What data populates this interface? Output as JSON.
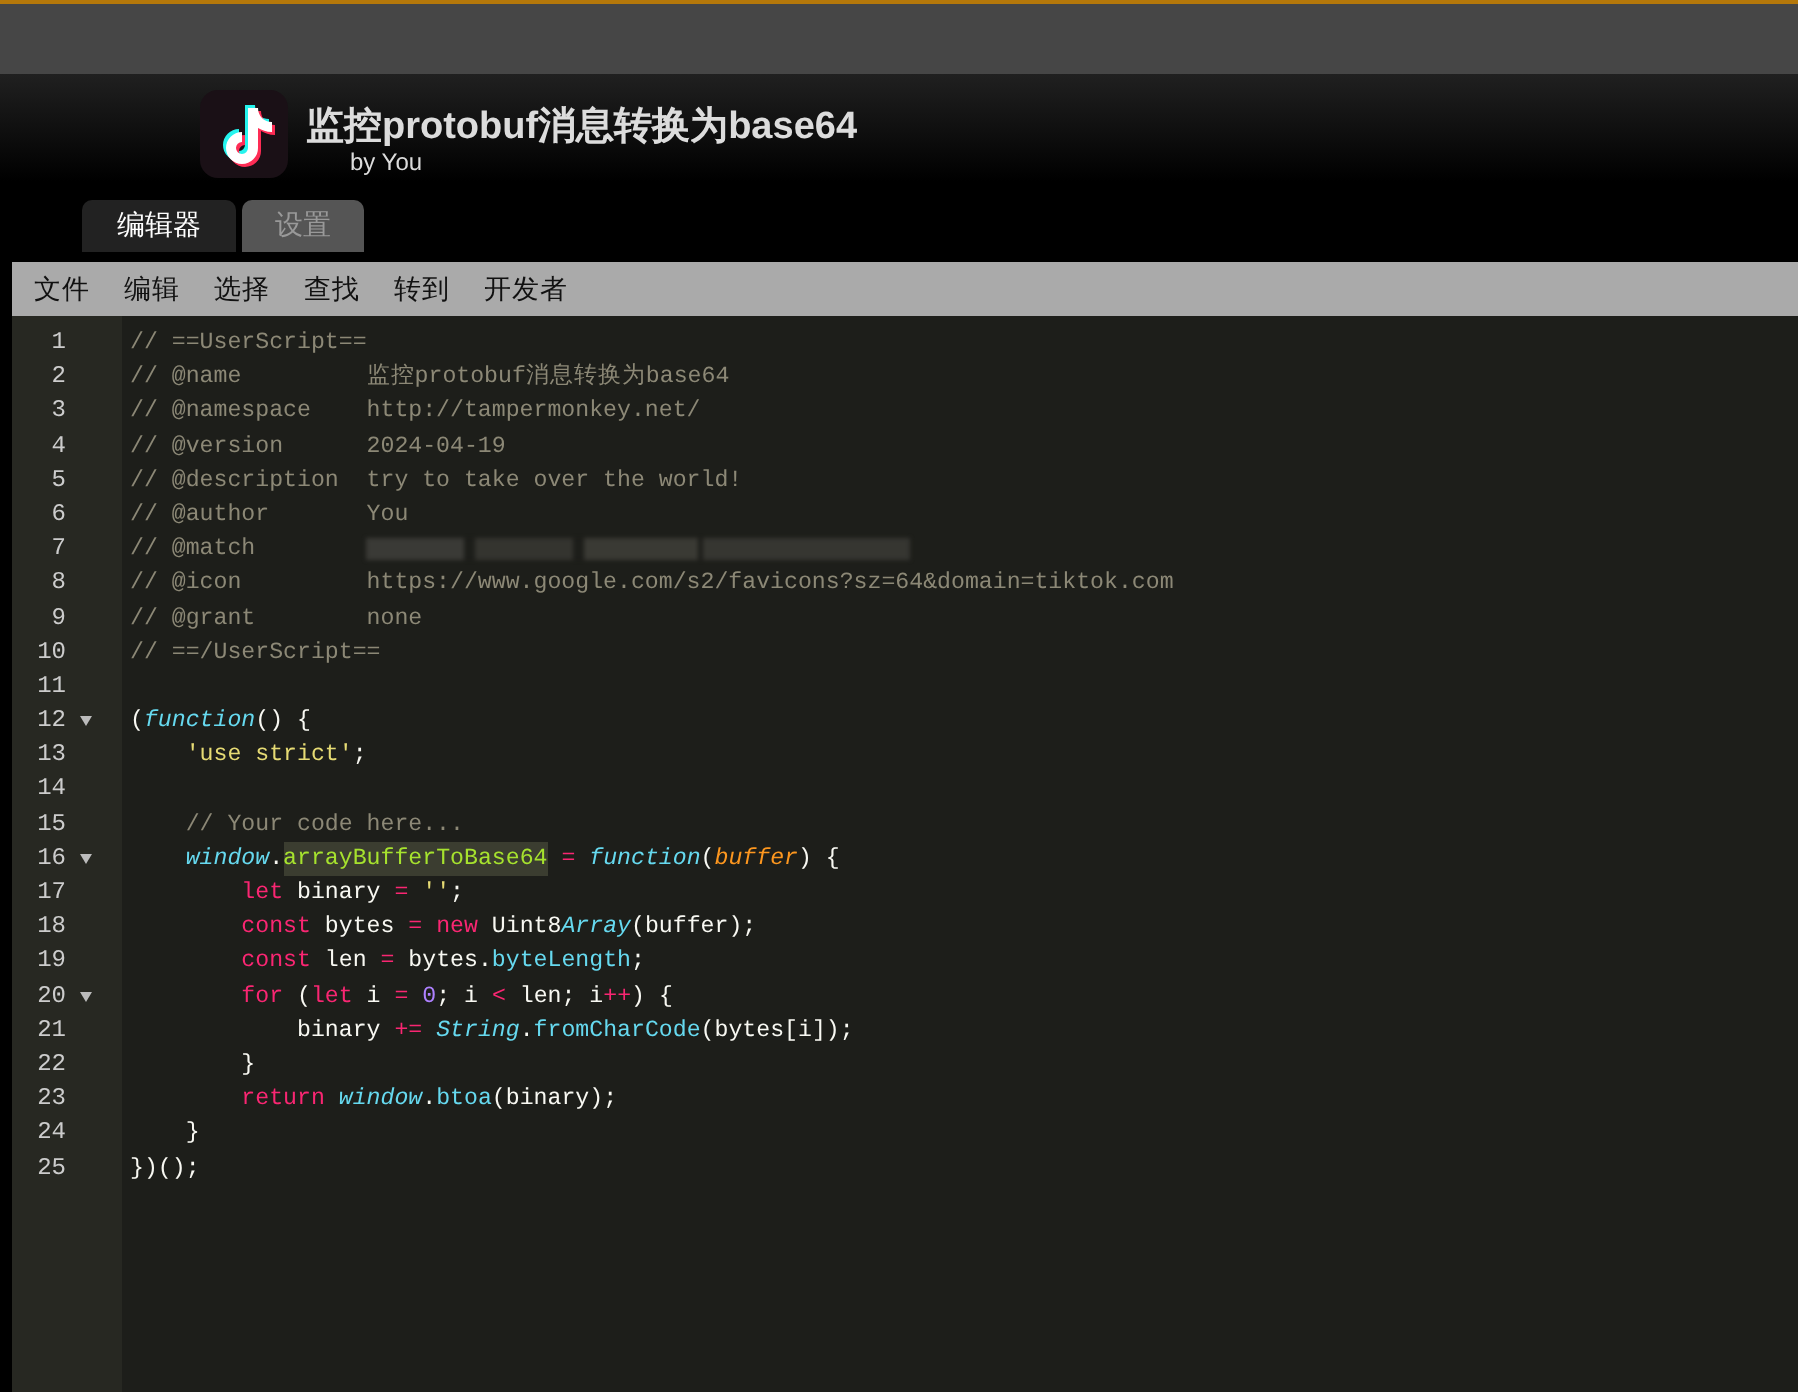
{
  "header": {
    "title": "监控protobuf消息转换为base64",
    "author": "by You"
  },
  "tabs": [
    {
      "label": "编辑器",
      "selected": true
    },
    {
      "label": "设置",
      "selected": false
    }
  ],
  "menu": [
    "文件",
    "编辑",
    "选择",
    "查找",
    "转到",
    "开发者"
  ],
  "code_lines": [
    {
      "number": "1",
      "foldable": false,
      "tokens": [
        {
          "text": "// ==UserScript==",
          "kind": "comment"
        }
      ]
    },
    {
      "number": "2",
      "foldable": false,
      "tokens": [
        {
          "text": "// @name         监控protobuf消息转换为base64",
          "kind": "comment"
        }
      ]
    },
    {
      "number": "3",
      "foldable": false,
      "tokens": [
        {
          "text": "// @namespace    http://tampermonkey.net/",
          "kind": "comment"
        }
      ]
    },
    {
      "number": "4",
      "foldable": false,
      "tokens": [
        {
          "text": "// @version      2024-04-19",
          "kind": "comment"
        }
      ]
    },
    {
      "number": "5",
      "foldable": false,
      "tokens": [
        {
          "text": "// @description  try to take over the world!",
          "kind": "comment"
        }
      ]
    },
    {
      "number": "6",
      "foldable": false,
      "tokens": [
        {
          "text": "// @author       You",
          "kind": "comment"
        }
      ]
    },
    {
      "number": "7",
      "foldable": false,
      "tokens": [
        {
          "text": "// @match        ",
          "kind": "comment"
        },
        {
          "kind": "redacted"
        }
      ]
    },
    {
      "number": "8",
      "foldable": false,
      "tokens": [
        {
          "text": "// @icon         https://www.google.com/s2/favicons?sz=64&domain=tiktok.com",
          "kind": "comment"
        }
      ]
    },
    {
      "number": "9",
      "foldable": false,
      "tokens": [
        {
          "text": "// @grant        none",
          "kind": "comment"
        }
      ]
    },
    {
      "number": "10",
      "foldable": false,
      "tokens": [
        {
          "text": "// ==/UserScript==",
          "kind": "comment"
        }
      ]
    },
    {
      "number": "11",
      "foldable": false
    },
    {
      "number": "12",
      "foldable": true,
      "tokens": [
        {
          "text": "(",
          "kind": "plain"
        },
        {
          "text": "function",
          "kind": "storage"
        },
        {
          "text": "() {",
          "kind": "plain"
        }
      ]
    },
    {
      "number": "13",
      "foldable": false,
      "tokens": [
        {
          "text": "    'use strict'",
          "kind": "string"
        },
        {
          "text": ";",
          "kind": "plain"
        }
      ]
    },
    {
      "number": "14",
      "foldable": false
    },
    {
      "number": "15",
      "foldable": false,
      "tokens": [
        {
          "text": "    // Your code here...",
          "kind": "comment"
        }
      ]
    },
    {
      "number": "16",
      "foldable": true,
      "tokens": [
        {
          "text": "    window",
          "kind": "storage"
        },
        {
          "text": ".",
          "kind": "plain"
        },
        {
          "text": "arrayBufferToBase64",
          "kind": "function-name"
        },
        {
          "text": " =",
          "kind": "keyword"
        },
        {
          "text": " function",
          "kind": "storage"
        },
        {
          "text": "(",
          "kind": "plain"
        },
        {
          "text": "buffer",
          "kind": "param"
        },
        {
          "text": ") {",
          "kind": "plain"
        }
      ]
    },
    {
      "number": "17",
      "foldable": false,
      "tokens": [
        {
          "text": "        let",
          "kind": "keyword"
        },
        {
          "text": " binary ",
          "kind": "plain"
        },
        {
          "text": "=",
          "kind": "keyword"
        },
        {
          "text": " ''",
          "kind": "string"
        },
        {
          "text": ";",
          "kind": "plain"
        }
      ]
    },
    {
      "number": "18",
      "foldable": false,
      "tokens": [
        {
          "text": "        const",
          "kind": "keyword"
        },
        {
          "text": " bytes ",
          "kind": "plain"
        },
        {
          "text": "=",
          "kind": "keyword"
        },
        {
          "text": " new",
          "kind": "keyword"
        },
        {
          "text": " Uint8",
          "kind": "plain"
        },
        {
          "text": "Array",
          "kind": "storage"
        },
        {
          "text": "(buffer);",
          "kind": "plain"
        }
      ]
    },
    {
      "number": "19",
      "foldable": false,
      "tokens": [
        {
          "text": "        const",
          "kind": "keyword"
        },
        {
          "text": " len ",
          "kind": "plain"
        },
        {
          "text": "=",
          "kind": "keyword"
        },
        {
          "text": " bytes.",
          "kind": "plain"
        },
        {
          "text": "byteLength",
          "kind": "support"
        },
        {
          "text": ";",
          "kind": "plain"
        }
      ]
    },
    {
      "number": "20",
      "foldable": true,
      "tokens": [
        {
          "text": "        for",
          "kind": "keyword"
        },
        {
          "text": " (",
          "kind": "plain"
        },
        {
          "text": "let",
          "kind": "keyword"
        },
        {
          "text": " i ",
          "kind": "plain"
        },
        {
          "text": "=",
          "kind": "keyword"
        },
        {
          "text": " 0",
          "kind": "number"
        },
        {
          "text": "; i ",
          "kind": "plain"
        },
        {
          "text": "<",
          "kind": "keyword"
        },
        {
          "text": " len; i",
          "kind": "plain"
        },
        {
          "text": "++",
          "kind": "keyword"
        },
        {
          "text": ") {",
          "kind": "plain"
        }
      ]
    },
    {
      "number": "21",
      "foldable": false,
      "tokens": [
        {
          "text": "            binary ",
          "kind": "plain"
        },
        {
          "text": "+=",
          "kind": "keyword"
        },
        {
          "text": " String",
          "kind": "storage"
        },
        {
          "text": ".",
          "kind": "plain"
        },
        {
          "text": "fromCharCode",
          "kind": "support"
        },
        {
          "text": "(bytes[i]);",
          "kind": "plain"
        }
      ]
    },
    {
      "number": "22",
      "foldable": false,
      "tokens": [
        {
          "text": "        }",
          "kind": "plain"
        }
      ]
    },
    {
      "number": "23",
      "foldable": false,
      "tokens": [
        {
          "text": "        return",
          "kind": "keyword"
        },
        {
          "text": " window",
          "kind": "storage"
        },
        {
          "text": ".",
          "kind": "plain"
        },
        {
          "text": "btoa",
          "kind": "support"
        },
        {
          "text": "(binary);",
          "kind": "plain"
        }
      ]
    },
    {
      "number": "24",
      "foldable": false,
      "tokens": [
        {
          "text": "    }",
          "kind": "plain"
        }
      ]
    },
    {
      "number": "25",
      "foldable": false,
      "tokens": [
        {
          "text": "})();",
          "kind": "plain"
        }
      ]
    }
  ]
}
